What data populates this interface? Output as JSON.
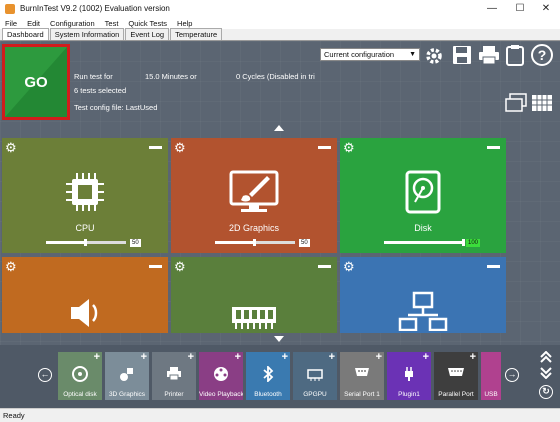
{
  "window": {
    "title": "BurnInTest V9.2 (1002) Evaluation version",
    "controls": [
      "minimize-icon",
      "maximize-icon",
      "close-icon"
    ]
  },
  "menu": [
    "File",
    "Edit",
    "Configuration",
    "Test",
    "Quick Tests",
    "Help"
  ],
  "tabs": [
    "Dashboard",
    "System Information",
    "Event Log",
    "Temperature"
  ],
  "go_label": "GO",
  "info": {
    "run_test_for": "Run test for",
    "minutes": "15.0 Minutes or",
    "cycles": "0 Cycles (Disabled in tri",
    "tests_selected": "6 tests selected",
    "config_file": "Test config file: LastUsed"
  },
  "config_select": "Current configuration",
  "toolbar_icons": [
    "gear-icon",
    "save-icon",
    "printer-icon",
    "clipboard-icon",
    "help-icon"
  ],
  "tiles": [
    {
      "label": "CPU",
      "count": "50",
      "color": "#6c7f38",
      "icon": "cpu-icon",
      "level": 0.5
    },
    {
      "label": "2D Graphics",
      "count": "50",
      "color": "#b2532f",
      "icon": "monitor-brush-icon",
      "level": 0.5
    },
    {
      "label": "Disk",
      "count": "100",
      "color": "#2aa33f",
      "icon": "disk-icon",
      "level": 1.0
    },
    {
      "label": "",
      "color": "#c06a20",
      "icon": "speaker-icon"
    },
    {
      "label": "",
      "color": "#5a7f3c",
      "icon": "memory-icon"
    },
    {
      "label": "",
      "color": "#3b74b3",
      "icon": "network-icon"
    }
  ],
  "dock": [
    {
      "label": "Optical disk",
      "color": "#6a8b6a"
    },
    {
      "label": "3D Graphics",
      "color": "#7c8d99"
    },
    {
      "label": "Printer",
      "color": "#6e7882"
    },
    {
      "label": "Video Playback",
      "color": "#8a3e85"
    },
    {
      "label": "Bluetooth",
      "color": "#3a7ab0"
    },
    {
      "label": "GPGPU",
      "color": "#4e6a82"
    },
    {
      "label": "Serial Port 1",
      "color": "#7a7a7a"
    },
    {
      "label": "Plugin1",
      "color": "#6b32b5"
    },
    {
      "label": "Parallel Port",
      "color": "#3e3e3e"
    },
    {
      "label": "USB",
      "color": "#b0418f"
    }
  ],
  "status": "Ready"
}
